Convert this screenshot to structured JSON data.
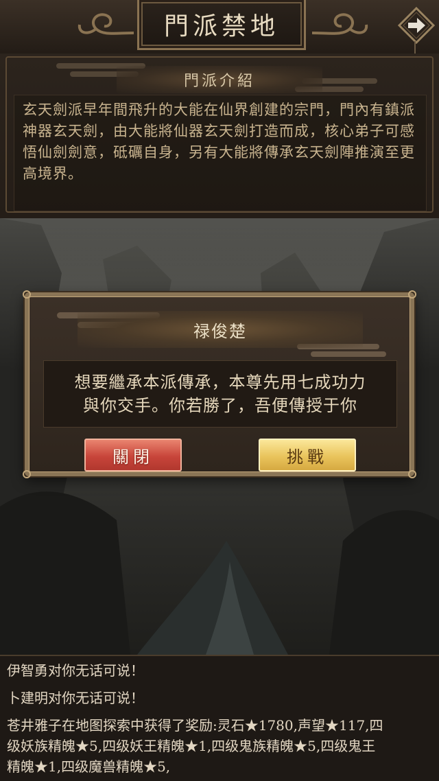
{
  "header": {
    "title": "門派禁地",
    "next_icon": "arrow-right-icon"
  },
  "intro": {
    "heading": "門派介紹",
    "text": "玄天劍派早年間飛升的大能在仙界創建的宗門，門內有鎮派神器玄天劍，由大能將仙器玄天劍打造而成，核心弟子可感悟仙劍劍意，砥礪自身，另有大能將傳承玄天劍陣推演至更高境界。"
  },
  "dialog": {
    "title": "禄俊楚",
    "message_line1": "想要繼承本派傳承，本尊先用七成功力",
    "message_line2": "與你交手。你若勝了，吾便傳授于你",
    "close_label": "關閉",
    "challenge_label": "挑戰"
  },
  "log": {
    "lines": [
      "伊智勇对你无话可说！",
      "卜建明对你无话可说！",
      "苍井雅子在地图探索中获得了奖励:灵石★1780,声望★117,四",
      "级妖族精魄★5,四级妖王精魄★1,四级鬼族精魄★5,四级鬼王",
      "精魄★1,四级魔兽精魄★5,"
    ]
  },
  "colors": {
    "close_button": "#c8453a",
    "challenge_button": "#e9c45c",
    "panel_text": "#c9b48f"
  }
}
